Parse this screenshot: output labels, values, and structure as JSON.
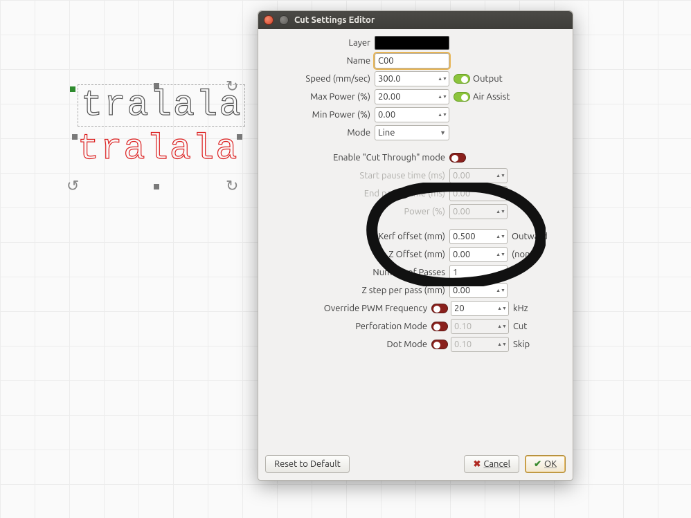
{
  "window": {
    "title": "Cut Settings Editor"
  },
  "canvas": {
    "text1": "tralala",
    "text2": "tralala"
  },
  "fields": {
    "layer_label": "Layer",
    "name_label": "Name",
    "name_value": "C00",
    "speed_label": "Speed (mm/sec)",
    "speed_value": "300.0",
    "output_label": "Output",
    "maxpower_label": "Max Power (%)",
    "maxpower_value": "20.00",
    "airassist_label": "Air Assist",
    "minpower_label": "Min Power (%)",
    "minpower_value": "0.00",
    "mode_label": "Mode",
    "mode_value": "Line",
    "cutthrough_label": "Enable \"Cut Through\" mode",
    "startpause_label": "Start pause time (ms)",
    "startpause_value": "0.00",
    "endpause_label": "End pause time (ms)",
    "endpause_value": "0.00",
    "power_label": "Power (%)",
    "power_value": "0.00",
    "kerf_label": "Kerf offset (mm)",
    "kerf_value": "0.500",
    "kerf_dir": "Outward",
    "zoffset_label": "Z Offset (mm)",
    "zoffset_value": "0.00",
    "zoffset_trail": "(none)",
    "passes_label": "Number of Passes",
    "passes_value": "1",
    "zstep_label": "Z step per pass  (mm)",
    "zstep_value": "0.00",
    "pwm_label": "Override PWM Frequency",
    "pwm_value": "20",
    "pwm_unit": "kHz",
    "perf_label": "Perforation Mode",
    "perf_value": "0.10",
    "perf_trail": "Cut",
    "dot_label": "Dot Mode",
    "dot_value": "0.10",
    "dot_trail": "Skip"
  },
  "buttons": {
    "reset": "Reset to Default",
    "cancel": "Cancel",
    "ok": "OK"
  }
}
